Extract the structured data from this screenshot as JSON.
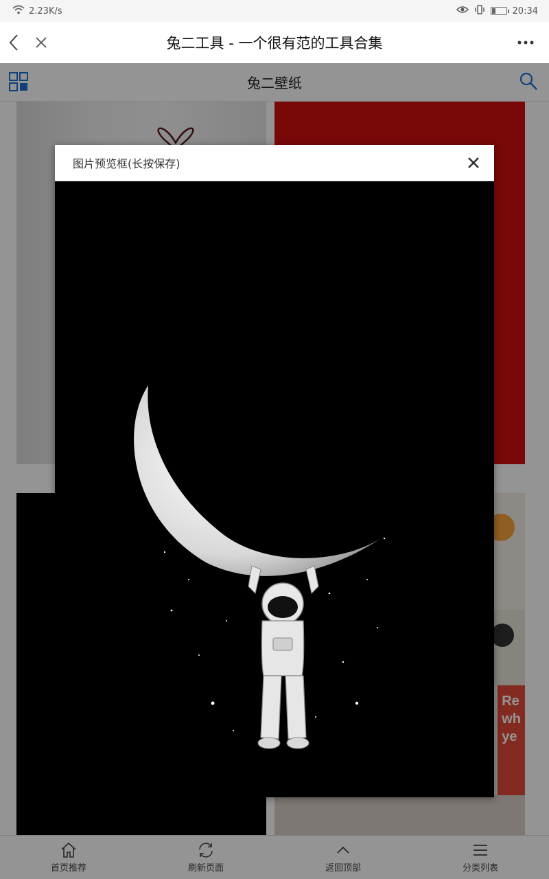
{
  "status_bar": {
    "network_speed": "2.23K/s",
    "time": "20:34"
  },
  "title_bar": {
    "title": "兔二工具 - 一个很有范的工具合集",
    "back_icon": "chevron-left-icon",
    "close_icon": "close-icon",
    "more_icon": "more-horizontal-icon"
  },
  "page_header": {
    "title": "兔二壁纸",
    "grid_icon": "grid-icon",
    "search_icon": "search-icon",
    "accent_color": "#1a73d6"
  },
  "dialog": {
    "title": "图片预览框(长按保存)",
    "close_icon": "close-icon",
    "image_subject": "astronaut hanging from crescent moon"
  },
  "bottom_nav": [
    {
      "label": "首页推荐",
      "icon": "home-icon"
    },
    {
      "label": "刷新页面",
      "icon": "refresh-icon"
    },
    {
      "label": "返回顶部",
      "icon": "chevron-up-icon"
    },
    {
      "label": "分类列表",
      "icon": "list-icon"
    }
  ],
  "tile_text": [
    "Re",
    "wh",
    "ye"
  ]
}
